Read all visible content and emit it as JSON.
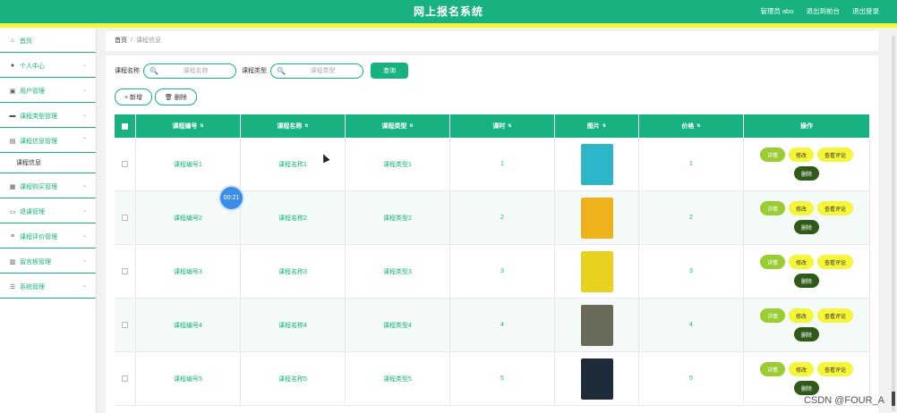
{
  "header": {
    "title": "网上报名系统",
    "admin": "管理员 abo",
    "back": "退出到前台",
    "logout": "退出登录"
  },
  "sidebar": {
    "items": [
      {
        "label": "首页",
        "icon": "home-icon",
        "glyph": "⌂",
        "chev": ""
      },
      {
        "label": "个人中心",
        "icon": "user-icon",
        "glyph": "●",
        "chev": "⌄"
      },
      {
        "label": "用户管理",
        "icon": "users-icon",
        "glyph": "▣",
        "chev": "⌄"
      },
      {
        "label": "课程类型管理",
        "icon": "chat-icon",
        "glyph": "▬",
        "chev": "⌄"
      },
      {
        "label": "课程信息管理",
        "icon": "document-icon",
        "glyph": "▤",
        "chev": "⌃"
      },
      {
        "label": "课程购买管理",
        "icon": "cart-icon",
        "glyph": "▦",
        "chev": "⌄"
      },
      {
        "label": "退课管理",
        "icon": "message-icon",
        "glyph": "▭",
        "chev": "⌄"
      },
      {
        "label": "课程评价管理",
        "icon": "list-icon",
        "glyph": "≡",
        "chev": "⌄"
      },
      {
        "label": "留言板管理",
        "icon": "board-icon",
        "glyph": "▥",
        "chev": "⌄"
      },
      {
        "label": "系统管理",
        "icon": "settings-icon",
        "glyph": "☰",
        "chev": "⌄"
      }
    ],
    "sub_item": "课程信息"
  },
  "breadcrumb": {
    "home": "首页",
    "sep": "/",
    "current": "课程信息"
  },
  "search": {
    "name_label": "课程名称",
    "name_placeholder": "课程名称",
    "type_label": "课程类型",
    "type_placeholder": "课程类型",
    "query": "查询",
    "search_glyph": "🔍"
  },
  "actions": {
    "add": "+ 新增",
    "delete": "🗑 删除"
  },
  "table": {
    "headers": [
      "课程编号",
      "课程名称",
      "课程类型",
      "课时",
      "图片",
      "价格",
      "操作"
    ],
    "sort_glyph": "⇅",
    "rows": [
      {
        "no": "课程编号1",
        "name": "课程名称1",
        "type": "课程类型1",
        "hours": "1",
        "price": "1",
        "cover_color": "#2db6c9"
      },
      {
        "no": "课程编号2",
        "name": "课程名称2",
        "type": "课程类型2",
        "hours": "2",
        "price": "2",
        "cover_color": "#f0b21a"
      },
      {
        "no": "课程编号3",
        "name": "课程名称3",
        "type": "课程类型3",
        "hours": "3",
        "price": "3",
        "cover_color": "#e8d21f"
      },
      {
        "no": "课程编号4",
        "name": "课程名称4",
        "type": "课程类型4",
        "hours": "4",
        "price": "4",
        "cover_color": "#6b6b5a"
      },
      {
        "no": "课程编号5",
        "name": "课程名称5",
        "type": "课程类型5",
        "hours": "5",
        "price": "5",
        "cover_color": "#1e2c3a"
      }
    ],
    "ops": {
      "detail": "详情",
      "edit": "修改",
      "review": "查看评论",
      "del": "删除"
    }
  },
  "overlay": {
    "timer": "00:21",
    "watermark": "CSDN @FOUR_A"
  },
  "colors": {
    "primary": "#17b27f",
    "accent_yellow": "#f5f53a",
    "detail_green": "#9acd32",
    "delete_dark": "#2f5a1a"
  }
}
